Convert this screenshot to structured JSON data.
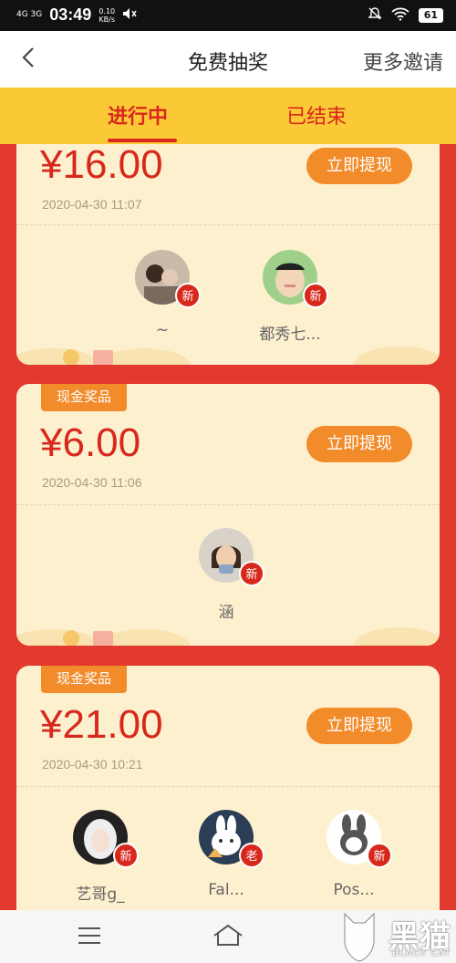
{
  "status_bar": {
    "network": "4G 3G",
    "time": "03:49",
    "speed_value": "0.10",
    "speed_unit": "KB/s",
    "battery": "61"
  },
  "nav": {
    "title": "免费抽奖",
    "more": "更多邀请"
  },
  "tabs": [
    {
      "label": "进行中"
    },
    {
      "label": "已结束"
    }
  ],
  "cards": [
    {
      "badge": "",
      "amount": "¥16.00",
      "date": "2020-04-30 11:07",
      "button": "立即提现",
      "users": [
        {
          "name": "~",
          "tag": "新"
        },
        {
          "name": "都秀七...",
          "tag": "新"
        }
      ]
    },
    {
      "badge": "现金奖品",
      "amount": "¥6.00",
      "date": "2020-04-30 11:06",
      "button": "立即提现",
      "users": [
        {
          "name": "涵",
          "tag": "新"
        }
      ]
    },
    {
      "badge": "现金奖品",
      "amount": "¥21.00",
      "date": "2020-04-30 10:21",
      "button": "立即提现",
      "users": [
        {
          "name": "艺哥g_",
          "tag": "新"
        },
        {
          "name": "Fal...",
          "tag": "老"
        },
        {
          "name": "Pos...",
          "tag": "新"
        }
      ]
    }
  ],
  "watermark": {
    "text": "黑猫",
    "sub": "BLACK CAT"
  }
}
